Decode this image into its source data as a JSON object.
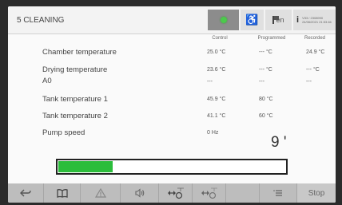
{
  "header": {
    "title": "5 CLEANING",
    "language": "en",
    "info_line1": "V33 / 2308990",
    "info_line2": "24/06/2021 21:53:46"
  },
  "columns": [
    "Control",
    "Programmed",
    "Recorded"
  ],
  "rows": [
    {
      "label": "Chamber temperature",
      "control": "25.0 °C",
      "programmed": "--- °C",
      "recorded": "24.9 °C"
    },
    {
      "label": "Drying temperature",
      "control": "23.6 °C",
      "programmed": "--- °C",
      "recorded": "--- °C"
    },
    {
      "label": "A0",
      "control": "---",
      "programmed": "---",
      "recorded": "---"
    },
    {
      "label": "Tank temperature 1",
      "control": "45.9 °C",
      "programmed": "80 °C",
      "recorded": ""
    },
    {
      "label": "Tank temperature 2",
      "control": "41.1 °C",
      "programmed": "60 °C",
      "recorded": ""
    },
    {
      "label": "Pump speed",
      "control": "0 Hz",
      "programmed": "",
      "recorded": ""
    }
  ],
  "countdown": "9 '",
  "progress": {
    "fraction": 0.24,
    "color": "#2bbd3b"
  },
  "footer": {
    "stop_label": "Stop",
    "icons": [
      "back-icon",
      "book-icon",
      "warning-icon",
      "speaker-icon",
      "door-lock-icon",
      "door-unlock-icon",
      "list-icon"
    ]
  }
}
